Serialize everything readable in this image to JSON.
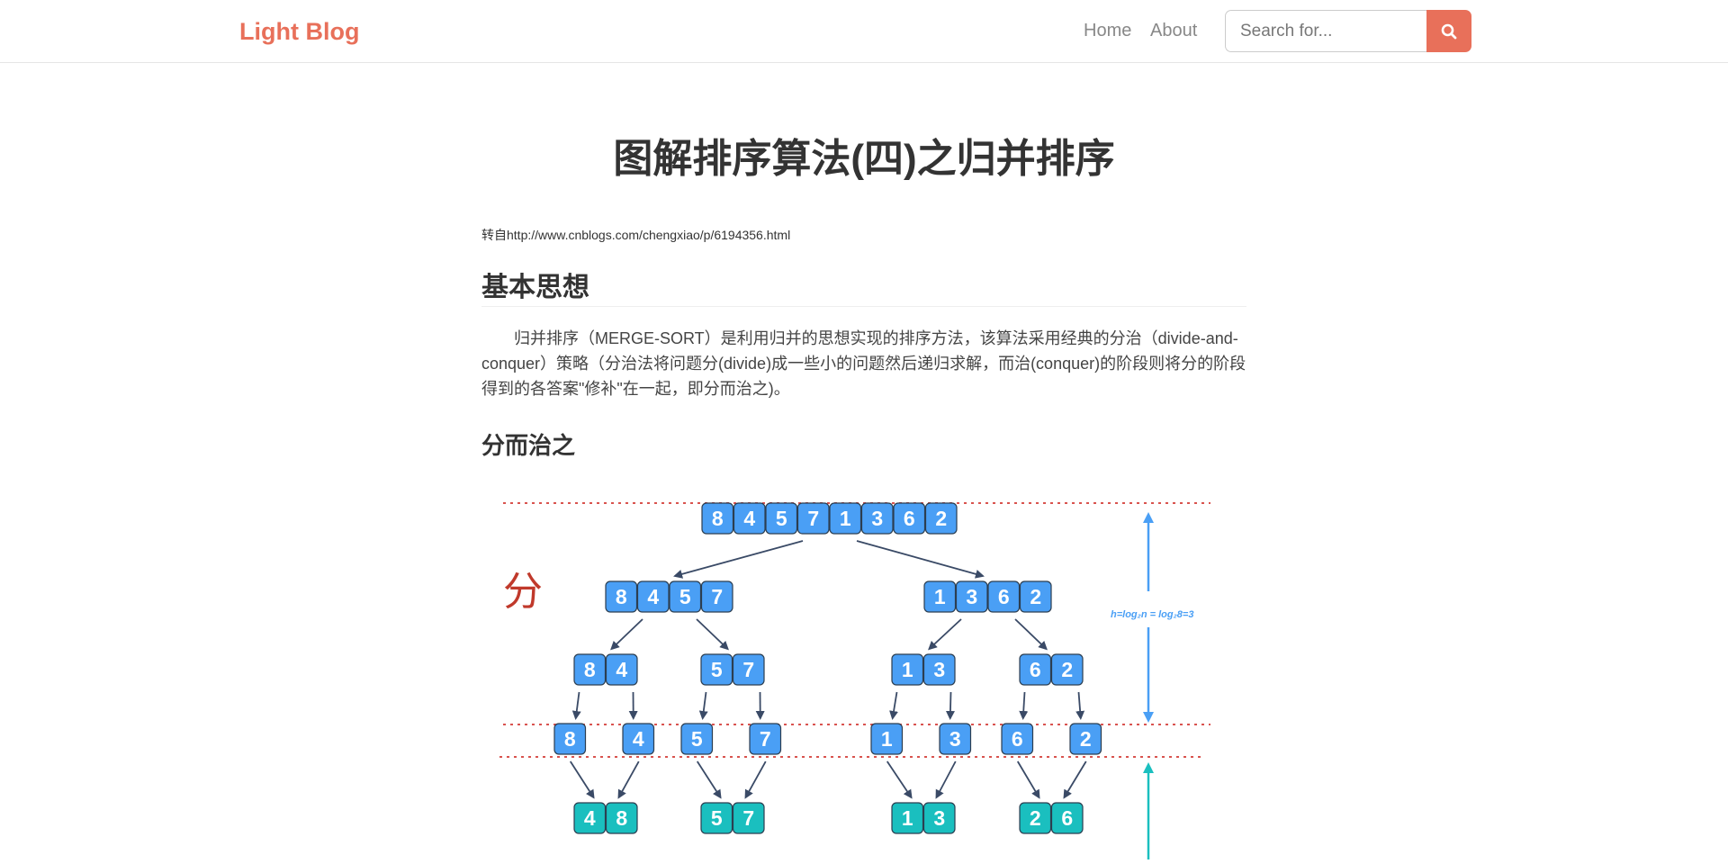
{
  "nav": {
    "brand": "Light Blog",
    "links": [
      "Home",
      "About"
    ],
    "search_placeholder": "Search for..."
  },
  "post": {
    "title": "图解排序算法(四)之归并排序",
    "source": "转自http://www.cnblogs.com/chengxiao/p/6194356.html",
    "section_heading": "基本思想",
    "paragraph": "归并排序（MERGE-SORT）是利用归并的思想实现的排序方法，该算法采用经典的分治（divide-and-conquer）策略（分治法将问题分(divide)成一些小的问题然后递归求解，而治(conquer)的阶段则将分的阶段得到的各答案\"修补\"在一起，即分而治之)。",
    "subsection_heading": "分而治之"
  },
  "diagram": {
    "divide_label": "分",
    "height_annotation": "h=log₂n = log₂8=3",
    "levels": [
      [
        [
          "8",
          "4",
          "5",
          "7",
          "1",
          "3",
          "6",
          "2"
        ]
      ],
      [
        [
          "8",
          "4",
          "5",
          "7"
        ],
        [
          "1",
          "3",
          "6",
          "2"
        ]
      ],
      [
        [
          "8",
          "4"
        ],
        [
          "5",
          "7"
        ],
        [
          "1",
          "3"
        ],
        [
          "6",
          "2"
        ]
      ],
      [
        [
          "8"
        ],
        [
          "4"
        ],
        [
          "5"
        ],
        [
          "7"
        ],
        [
          "1"
        ],
        [
          "3"
        ],
        [
          "6"
        ],
        [
          "2"
        ]
      ],
      [
        [
          "4",
          "8"
        ],
        [
          "5",
          "7"
        ],
        [
          "1",
          "3"
        ],
        [
          "2",
          "6"
        ]
      ]
    ],
    "colors": {
      "divide_box": "#4a9ff5",
      "merge_box": "#1abfbf",
      "guide_line": "#d9534f",
      "height_arrow": "#4a9ff5",
      "merge_arrow": "#1abfbf"
    }
  }
}
